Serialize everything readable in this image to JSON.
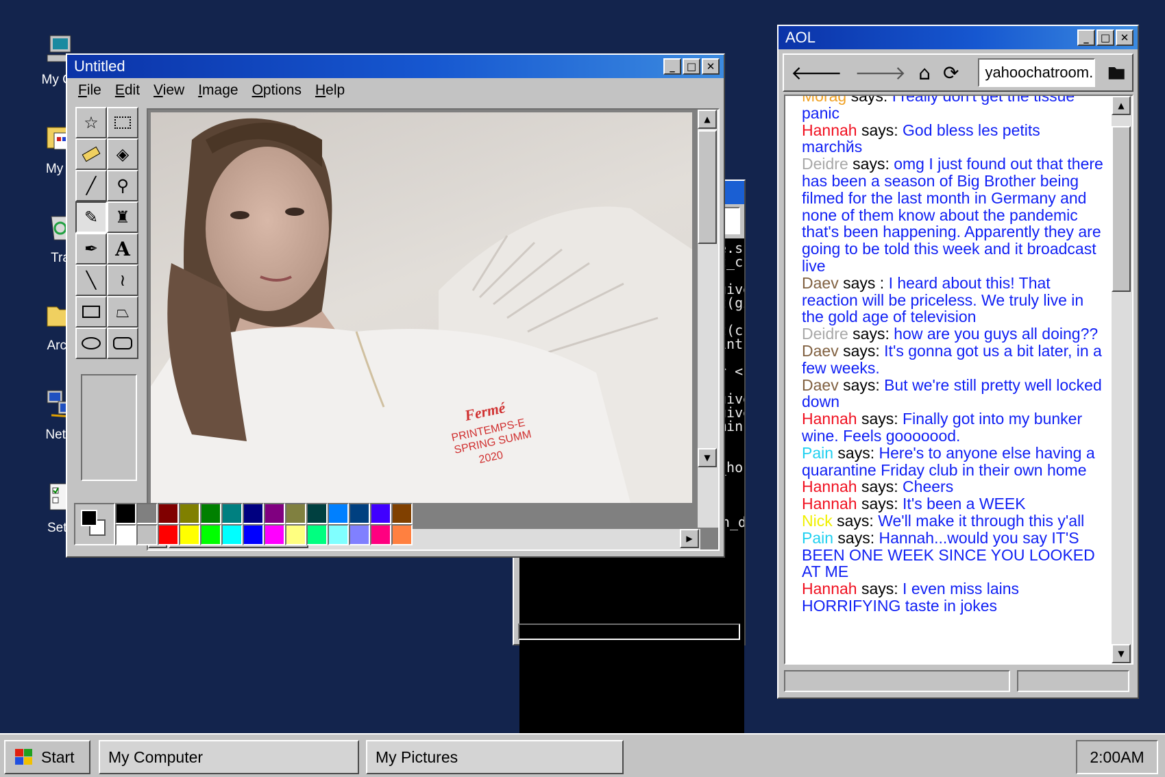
{
  "desktop": {
    "icons": [
      {
        "label": "My Co",
        "icon": "computer-icon"
      },
      {
        "label": "My F",
        "icon": "documents-icon"
      },
      {
        "label": "Tra",
        "icon": "recycle-bin-icon"
      },
      {
        "label": "Arch",
        "icon": "folder-icon"
      },
      {
        "label": "Netw",
        "icon": "network-icon"
      },
      {
        "label": "Setti",
        "icon": "settings-icon"
      }
    ]
  },
  "paint": {
    "title": "Untitled",
    "menu": [
      "File",
      "Edit",
      "View",
      "Image",
      "Options",
      "Help"
    ],
    "shirt_text": [
      "Fermé",
      "PRINTEMPS-E",
      "SPRING SUMM",
      "2020"
    ],
    "palette_top": [
      "#000000",
      "#808080",
      "#800000",
      "#808000",
      "#008000",
      "#008080",
      "#000080",
      "#800080",
      "#808040",
      "#004040",
      "#0080ff",
      "#004080",
      "#4000ff",
      "#804000"
    ],
    "palette_bottom": [
      "#ffffff",
      "#c0c0c0",
      "#ff0000",
      "#ffff00",
      "#00ff00",
      "#00ffff",
      "#0000ff",
      "#ff00ff",
      "#ffff80",
      "#00ff80",
      "#80ffff",
      "#8080ff",
      "#ff0080",
      "#ff8040"
    ]
  },
  "terminal": {
    "lines": [
      "e.split",
      "t_curr",
      "",
      "given_",
      "t(give",
      "",
      "t(curr",
      "int(cu",
      "",
      "r < 24",
      "(",
      "given_h",
      "given_h",
      "minute",
      "",
      "",
      "_hour",
      "",
      "",
      "",
      "def is_valid_date(given_date)",
      "    \"\"\""
    ]
  },
  "aol": {
    "title": "AOL",
    "url": "yahoochatroom.c",
    "messages": [
      {
        "user": "Morag",
        "color": "#f0a020",
        "text": "I really don't get the tissue panic"
      },
      {
        "user": "Hannah",
        "color": "#f01020",
        "text": "God bless les petits marchйs"
      },
      {
        "user": "Deidre",
        "color": "#a8a8a8",
        "text": "omg I just found out that there has been a season of Big Brother being filmed for the last month in Germany and none of them know about the pandemic that's been happening. Apparently they are going to be told this week and it broadcast live"
      },
      {
        "user": "Daev",
        "color": "#806040",
        "sep": "says :",
        "text": "I heard about this! That reaction will be priceless. We truly live in the gold age of television"
      },
      {
        "user": "Deidre",
        "color": "#a8a8a8",
        "text": "how are you guys all doing??"
      },
      {
        "user": "Daev",
        "color": "#806040",
        "text": "It's gonna got us a bit later, in a few weeks."
      },
      {
        "user": "Daev",
        "color": "#806040",
        "text": "But we're still pretty well locked down"
      },
      {
        "user": "Hannah",
        "color": "#f01020",
        "text": "Finally got into my bunker wine. Feels gooooood."
      },
      {
        "user": "Pain",
        "color": "#20d0f0",
        "text": "Here's to anyone else having a quarantine Friday club in their own home"
      },
      {
        "user": "Hannah",
        "color": "#f01020",
        "text": "Cheers"
      },
      {
        "user": "Hannah",
        "color": "#f01020",
        "text": "It's been a WEEK"
      },
      {
        "user": "Nick",
        "color": "#f0f000",
        "text": "We'll make it through this y'all"
      },
      {
        "user": "Pain",
        "color": "#20d0f0",
        "text": "Hannah...would you say IT'S BEEN ONE WEEK SINCE YOU LOOKED AT ME"
      },
      {
        "user": "Hannah",
        "color": "#f01020",
        "text": "I even miss lains HORRIFYING taste in jokes"
      }
    ],
    "says": "says:"
  },
  "taskbar": {
    "start": "Start",
    "items": [
      "My Computer",
      "My Pictures"
    ],
    "clock": "2:00AM"
  }
}
